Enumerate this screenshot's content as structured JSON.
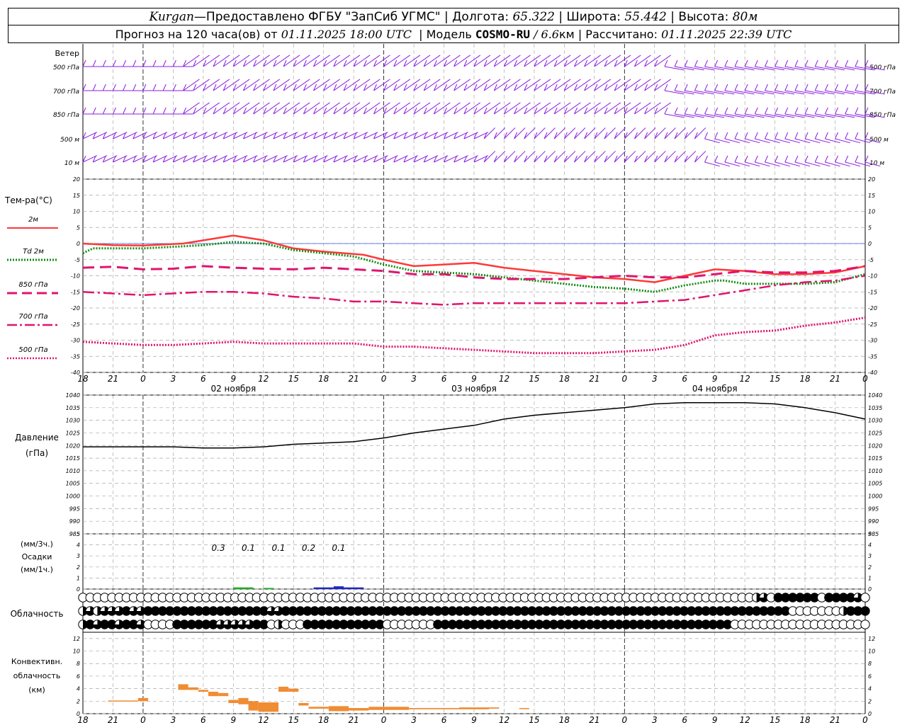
{
  "header": {
    "station": "Kurgan",
    "dash": " — ",
    "provider": "Предоставлено ФГБУ \"ЗапСиб УГМС\"",
    "lon_label": "Долгота:",
    "lon_value": "65.322",
    "lat_label": "Широта:",
    "lat_value": "55.442",
    "alt_label": "Высота:",
    "alt_value": "80м",
    "forecast_prefix": "Прогноз на 120 часа(ов) от",
    "forecast_time": "01.11.2025 18:00 UTC",
    "model_label": "Модель",
    "model_name": "COSMO-RU",
    "model_res": "/ 6.6",
    "model_res_unit": "км",
    "calc_label": "Рассчитано:",
    "calc_time": "01.11.2025 22:39 UTC",
    "sep": "|"
  },
  "colors": {
    "t2m": "#ff3838",
    "td2m": "#148c14",
    "t850": "#e0146e",
    "t700": "#e0146e",
    "t500": "#e0146e",
    "wind": "#8a1ee0",
    "pressure": "#000000",
    "precip_green": "#14b414",
    "precip_blue": "#1e28c8",
    "convective": "#f08c32",
    "grid": "#a8a8a8",
    "zero_line": "#3a5ae6"
  },
  "wind_panel": {
    "title": "Ветер",
    "levels": [
      "500 гПа",
      "700 гПа",
      "850 гПа",
      "500 м",
      "10 м"
    ],
    "right_levels": [
      "500 гПа",
      "700 гПа",
      "850 гПа",
      "500 м",
      "10 м"
    ]
  },
  "temp_panel": {
    "title": "Тем-ра(°C)",
    "legend": [
      {
        "label": "2м",
        "color": "#ff3838",
        "style": "solid"
      },
      {
        "label": "Td  2м",
        "color": "#148c14",
        "style": "dotted-thick"
      },
      {
        "label": "850 гПа",
        "color": "#e0146e",
        "style": "dashed"
      },
      {
        "label": "700 гПа",
        "color": "#e0146e",
        "style": "dashdot"
      },
      {
        "label": "500 гПа",
        "color": "#e0146e",
        "style": "dotted"
      }
    ],
    "yticks": [
      20,
      15,
      10,
      5,
      0,
      -5,
      -10,
      -15,
      -20,
      -25,
      -30,
      -35,
      -40
    ]
  },
  "time_axis": {
    "hour_labels": [
      "18",
      "21",
      "0",
      "3",
      "6",
      "9",
      "12",
      "15",
      "18",
      "21",
      "0",
      "3",
      "6",
      "9",
      "12",
      "15",
      "18",
      "21",
      "0",
      "3",
      "6",
      "9",
      "12",
      "15",
      "18",
      "21",
      "0"
    ],
    "date_labels": [
      {
        "text": "02 ноября",
        "hour": 15
      },
      {
        "text": "03 ноября",
        "hour": 39
      },
      {
        "text": "04 ноября",
        "hour": 63
      }
    ]
  },
  "pressure_panel": {
    "title_line1": "Давление",
    "title_line2": "(гПа)",
    "yticks": [
      1040,
      1035,
      1030,
      1025,
      1020,
      1015,
      1010,
      1005,
      1000,
      995,
      990,
      985
    ]
  },
  "precip_panel": {
    "unit_top": "(мм/3ч.)",
    "title": "Осадки",
    "unit_bottom": "(мм/1ч.)",
    "yticks": [
      5,
      4,
      3,
      2,
      1,
      0
    ],
    "labels": [
      {
        "hour": 15,
        "text": "0.3"
      },
      {
        "hour": 18,
        "text": "0.1"
      },
      {
        "hour": 21,
        "text": "0.1"
      },
      {
        "hour": 24,
        "text": "0.2"
      },
      {
        "hour": 27,
        "text": "0.1"
      }
    ]
  },
  "cloud_panel": {
    "title": "Облачность"
  },
  "conv_panel": {
    "title_line1": "Конвективн.",
    "title_line2": "облачность",
    "title_line3": "(км)",
    "yticks": [
      12,
      10,
      8,
      6,
      4,
      2,
      0
    ]
  },
  "chart_data": {
    "type": "line",
    "x_hours": [
      0,
      1,
      2,
      3,
      4,
      5,
      6,
      7,
      8,
      9,
      10,
      11,
      12,
      13,
      14,
      15,
      16,
      17,
      18,
      19,
      20,
      21,
      22,
      23,
      24,
      25,
      26,
      27,
      28,
      29,
      30,
      31,
      32,
      33,
      34,
      35,
      36,
      37,
      38,
      39,
      40,
      41,
      42,
      43,
      44,
      45,
      46,
      47,
      48,
      49,
      50,
      51,
      52,
      53,
      54,
      55,
      56,
      57,
      58,
      59,
      60,
      61,
      62,
      63,
      64,
      65,
      66,
      67,
      68,
      69,
      70,
      71,
      72,
      73,
      74,
      75,
      76,
      77,
      78
    ],
    "x_unit": "hours after 01.11.2025 18:00 UTC",
    "series": [
      {
        "name": "2м",
        "unit": "°C",
        "points": [
          [
            0,
            0
          ],
          [
            3,
            -0.5
          ],
          [
            6,
            -0.6
          ],
          [
            10,
            0
          ],
          [
            15,
            2.5
          ],
          [
            18,
            1
          ],
          [
            21,
            -1.5
          ],
          [
            24,
            -2.5
          ],
          [
            28,
            -3.5
          ],
          [
            30,
            -5
          ],
          [
            33,
            -7
          ],
          [
            36,
            -6.5
          ],
          [
            39,
            -6
          ],
          [
            42,
            -7.5
          ],
          [
            45,
            -8.5
          ],
          [
            48,
            -9.5
          ],
          [
            51,
            -10.5
          ],
          [
            54,
            -11
          ],
          [
            57,
            -12
          ],
          [
            60,
            -10
          ],
          [
            63,
            -8
          ],
          [
            66,
            -8.5
          ],
          [
            69,
            -9.5
          ],
          [
            72,
            -9.5
          ],
          [
            75,
            -9
          ],
          [
            78,
            -7
          ]
        ]
      },
      {
        "name": "Td  2м",
        "unit": "°C",
        "points": [
          [
            0,
            -3
          ],
          [
            1,
            -1.5
          ],
          [
            3,
            -1.5
          ],
          [
            6,
            -1.5
          ],
          [
            9,
            -1
          ],
          [
            12,
            -0.5
          ],
          [
            15,
            0.5
          ],
          [
            18,
            0
          ],
          [
            21,
            -2
          ],
          [
            24,
            -3
          ],
          [
            27,
            -4
          ],
          [
            30,
            -6.5
          ],
          [
            33,
            -8.5
          ],
          [
            36,
            -9
          ],
          [
            39,
            -9.5
          ],
          [
            42,
            -10.5
          ],
          [
            45,
            -11.5
          ],
          [
            48,
            -12.5
          ],
          [
            51,
            -13.5
          ],
          [
            54,
            -14
          ],
          [
            57,
            -15
          ],
          [
            60,
            -13
          ],
          [
            63,
            -11.5
          ],
          [
            64,
            -11.5
          ],
          [
            66,
            -12.5
          ],
          [
            69,
            -12.5
          ],
          [
            72,
            -12.5
          ],
          [
            75,
            -12
          ],
          [
            78,
            -9.5
          ]
        ]
      },
      {
        "name": "850 гПа",
        "unit": "°C",
        "points": [
          [
            0,
            -7.5
          ],
          [
            3,
            -7.2
          ],
          [
            6,
            -8
          ],
          [
            9,
            -7.8
          ],
          [
            12,
            -7
          ],
          [
            15,
            -7.5
          ],
          [
            18,
            -7.8
          ],
          [
            21,
            -8
          ],
          [
            24,
            -7.5
          ],
          [
            27,
            -8
          ],
          [
            30,
            -8.5
          ],
          [
            33,
            -9.5
          ],
          [
            36,
            -9.5
          ],
          [
            39,
            -10.5
          ],
          [
            42,
            -11
          ],
          [
            45,
            -11
          ],
          [
            48,
            -11
          ],
          [
            51,
            -10.5
          ],
          [
            54,
            -10
          ],
          [
            57,
            -10.5
          ],
          [
            60,
            -10.5
          ],
          [
            63,
            -9.5
          ],
          [
            66,
            -8.5
          ],
          [
            69,
            -9
          ],
          [
            72,
            -9
          ],
          [
            75,
            -8.5
          ],
          [
            78,
            -7
          ]
        ]
      },
      {
        "name": "700 гПа",
        "unit": "°C",
        "points": [
          [
            0,
            -15
          ],
          [
            3,
            -15.5
          ],
          [
            6,
            -16
          ],
          [
            9,
            -15.5
          ],
          [
            12,
            -15
          ],
          [
            15,
            -15
          ],
          [
            18,
            -15.5
          ],
          [
            21,
            -16.5
          ],
          [
            24,
            -17
          ],
          [
            27,
            -18
          ],
          [
            30,
            -18
          ],
          [
            33,
            -18.5
          ],
          [
            36,
            -19
          ],
          [
            39,
            -18.5
          ],
          [
            42,
            -18.5
          ],
          [
            45,
            -18.5
          ],
          [
            48,
            -18.5
          ],
          [
            51,
            -18.5
          ],
          [
            54,
            -18.5
          ],
          [
            57,
            -18
          ],
          [
            60,
            -17.5
          ],
          [
            63,
            -16
          ],
          [
            66,
            -14.5
          ],
          [
            69,
            -13
          ],
          [
            72,
            -12
          ],
          [
            75,
            -11.5
          ],
          [
            78,
            -10
          ]
        ]
      },
      {
        "name": "500 гПа",
        "unit": "°C",
        "points": [
          [
            0,
            -30.5
          ],
          [
            3,
            -31
          ],
          [
            6,
            -31.5
          ],
          [
            9,
            -31.5
          ],
          [
            12,
            -31
          ],
          [
            15,
            -30.5
          ],
          [
            18,
            -31
          ],
          [
            21,
            -31
          ],
          [
            24,
            -31
          ],
          [
            27,
            -31
          ],
          [
            30,
            -32
          ],
          [
            33,
            -32
          ],
          [
            36,
            -32.5
          ],
          [
            39,
            -33
          ],
          [
            42,
            -33.5
          ],
          [
            45,
            -34
          ],
          [
            48,
            -34
          ],
          [
            51,
            -34
          ],
          [
            54,
            -33.5
          ],
          [
            57,
            -33
          ],
          [
            60,
            -31.5
          ],
          [
            63,
            -28.5
          ],
          [
            66,
            -27.5
          ],
          [
            69,
            -27
          ],
          [
            72,
            -25.5
          ],
          [
            75,
            -24.5
          ],
          [
            78,
            -23
          ]
        ]
      },
      {
        "name": "Давление",
        "unit": "гПа",
        "points": [
          [
            0,
            1019.5
          ],
          [
            3,
            1019.5
          ],
          [
            6,
            1019.5
          ],
          [
            9,
            1019.5
          ],
          [
            12,
            1019
          ],
          [
            15,
            1019
          ],
          [
            18,
            1019.5
          ],
          [
            21,
            1020.5
          ],
          [
            24,
            1021
          ],
          [
            27,
            1021.5
          ],
          [
            30,
            1023
          ],
          [
            33,
            1025
          ],
          [
            36,
            1026.5
          ],
          [
            39,
            1028
          ],
          [
            42,
            1030.5
          ],
          [
            45,
            1032
          ],
          [
            48,
            1033
          ],
          [
            51,
            1034
          ],
          [
            54,
            1035
          ],
          [
            57,
            1036.5
          ],
          [
            60,
            1037
          ],
          [
            63,
            1037
          ],
          [
            66,
            1037
          ],
          [
            69,
            1036.5
          ],
          [
            72,
            1035
          ],
          [
            75,
            1033
          ],
          [
            78,
            1030.5
          ]
        ]
      }
    ],
    "precipitation": [
      {
        "start": 15,
        "end": 17,
        "value": 0.15,
        "color": "green"
      },
      {
        "start": 18,
        "end": 19,
        "value": 0.1,
        "color": "green"
      },
      {
        "start": 23,
        "end": 25,
        "value": 0.15,
        "color": "blue"
      },
      {
        "start": 25,
        "end": 26,
        "value": 0.25,
        "color": "blue"
      },
      {
        "start": 26,
        "end": 28,
        "value": 0.15,
        "color": "blue"
      }
    ],
    "convective_cloud_km": [
      {
        "start": 2.5,
        "end": 5.5,
        "bottom": 2,
        "top": 2.1
      },
      {
        "start": 5.5,
        "end": 6.5,
        "bottom": 2,
        "top": 2.5
      },
      {
        "start": 9.5,
        "end": 10.5,
        "bottom": 3.8,
        "top": 4.7
      },
      {
        "start": 10.5,
        "end": 11.5,
        "bottom": 3.8,
        "top": 4.2
      },
      {
        "start": 11.5,
        "end": 12.5,
        "bottom": 3.5,
        "top": 3.8
      },
      {
        "start": 12.5,
        "end": 13.5,
        "bottom": 2.8,
        "top": 3.5
      },
      {
        "start": 13.5,
        "end": 14.5,
        "bottom": 2.8,
        "top": 3.3
      },
      {
        "start": 14.5,
        "end": 15.5,
        "bottom": 1.7,
        "top": 2.2
      },
      {
        "start": 15.5,
        "end": 16.5,
        "bottom": 1.5,
        "top": 2.5
      },
      {
        "start": 16.5,
        "end": 17.5,
        "bottom": 0.5,
        "top": 2
      },
      {
        "start": 17.5,
        "end": 19.5,
        "bottom": 0.3,
        "top": 1.8
      },
      {
        "start": 19.5,
        "end": 20.5,
        "bottom": 3.5,
        "top": 4.3
      },
      {
        "start": 20.5,
        "end": 21.5,
        "bottom": 3.5,
        "top": 4.0
      },
      {
        "start": 21.5,
        "end": 22.5,
        "bottom": 1.3,
        "top": 1.7
      },
      {
        "start": 22.5,
        "end": 24.5,
        "bottom": 0.8,
        "top": 1.1
      },
      {
        "start": 24.5,
        "end": 26.5,
        "bottom": 0.4,
        "top": 1.2
      },
      {
        "start": 26.5,
        "end": 28.5,
        "bottom": 0.5,
        "top": 0.9
      },
      {
        "start": 28.5,
        "end": 32.5,
        "bottom": 0.6,
        "top": 1.1
      },
      {
        "start": 32.5,
        "end": 37.5,
        "bottom": 0.7,
        "top": 0.9
      },
      {
        "start": 37.5,
        "end": 40.5,
        "bottom": 0.7,
        "top": 1.0
      },
      {
        "start": 40.5,
        "end": 41.5,
        "bottom": 0.8,
        "top": 1.0
      },
      {
        "start": 43.5,
        "end": 44.5,
        "bottom": 0.8,
        "top": 0.9
      }
    ],
    "cloud_cover_rows": [
      "0000000000000000000000000000000000000000000000000000000000000000000000000000000000000000000002304444440444430",
      "2323334334444444444444444433444444444444444444444444444444444444444444444444444444444444444444444400000002444",
      "2434434430000444444333334402000444444444440000000444444444444444444444444444444444444444440000000000000000000"
    ],
    "ylim_temp": [
      -40,
      20
    ],
    "ylim_pressure": [
      985,
      1040
    ],
    "ylim_precip": [
      0,
      5
    ],
    "ylim_conv": [
      0,
      13
    ],
    "grid": true
  }
}
